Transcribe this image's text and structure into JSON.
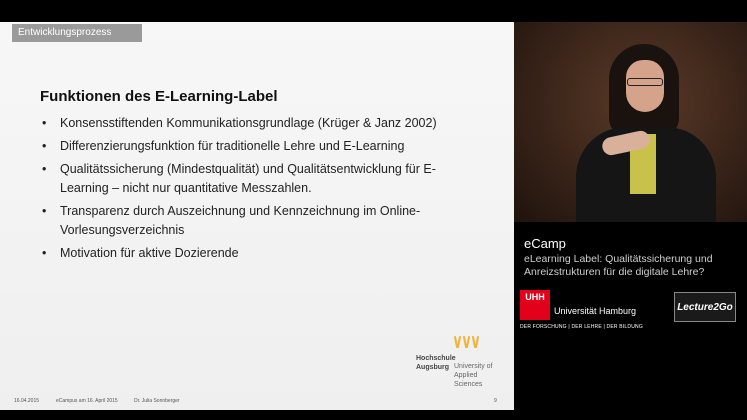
{
  "slide": {
    "section_tag": "Entwicklungsprozess",
    "title": "Funktionen des E-Learning-Label",
    "bullet_char": "•",
    "bullets": [
      "Konsensstiftenden Kommunikationsgrundlage (Krüger & Janz 2002)",
      "Differenzierungsfunktion für traditionelle Lehre und E-Learning",
      "Qualitätssicherung (Mindestqualität) und Qualitätsentwicklung für E-Learning – nicht nur quantitative Messzahlen.",
      "Transparenz durch Auszeichnung und Kennzeichnung im Online-Vorlesungsverzeichnis",
      "Motivation für aktive Dozierende"
    ],
    "logo": {
      "name_line1": "Hochschule",
      "name_line2": "Augsburg",
      "sub_line1": "University of",
      "sub_line2": "Applied Sciences",
      "icon": "hochschule-augsburg-logo-icon",
      "accent_color": "#f2b234"
    },
    "footer": {
      "date": "16.04.2015",
      "event": "eCampus am 16. April 2015",
      "author": "Dr. Julia Sonnberger",
      "page": "9"
    }
  },
  "info": {
    "title": "eCamp",
    "subtitle": "eLearning Label: Qualitätssicherung und Anreizstrukturen für die digitale Lehre?",
    "university": {
      "logo_text": "UHH",
      "name": "Universität Hamburg",
      "tagline": "DER FORSCHUNG | DER LEHRE | DER BILDUNG",
      "brand_color": "#e2001a"
    },
    "lecture2go": "Lecture2Go"
  }
}
